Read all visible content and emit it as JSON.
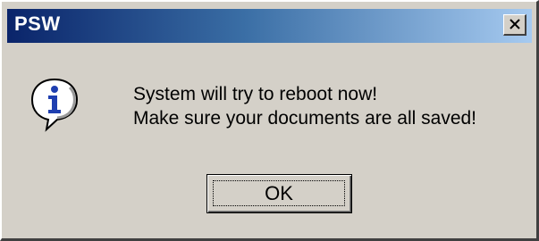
{
  "window": {
    "title": "PSW",
    "close_icon": "close-x-icon"
  },
  "dialog": {
    "icon": "information-icon",
    "message_lines": [
      "System will try to reboot now!",
      "Make sure your documents are all saved!"
    ],
    "ok_label": "OK"
  },
  "colors": {
    "titlebar_start": "#0a246a",
    "titlebar_end": "#a6caf0",
    "face": "#d4d0c8",
    "info_blue": "#1f3fb0"
  }
}
